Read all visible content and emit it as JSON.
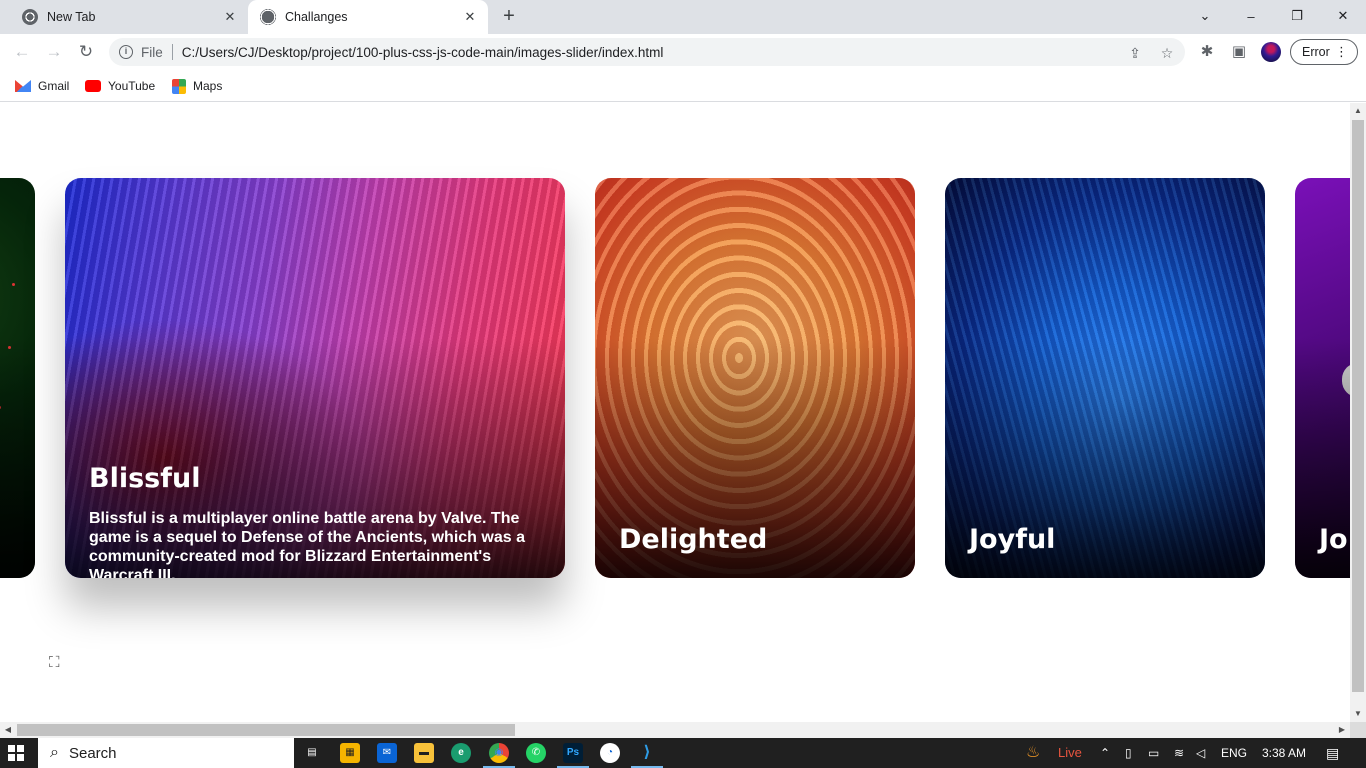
{
  "browser": {
    "tabs": [
      {
        "title": "New Tab",
        "close_glyph": "✕"
      },
      {
        "title": "Challanges",
        "close_glyph": "✕"
      }
    ],
    "new_tab_glyph": "+",
    "window_controls": {
      "menu": "⌄",
      "minimize": "–",
      "restore": "❐",
      "close": "✕"
    },
    "nav": {
      "back": "←",
      "forward": "→",
      "reload": "↻"
    },
    "address": {
      "info_glyph": "i",
      "scheme_label": "File",
      "url": "C:/Users/CJ/Desktop/project/100-plus-css-js-code-main/images-slider/index.html",
      "share_glyph": "⇪",
      "star_glyph": "☆"
    },
    "toolbar": {
      "extensions_glyph": "✱",
      "sidepanel_glyph": "▣",
      "error_label": "Error",
      "menu_glyph": "⋮"
    },
    "bookmarks": [
      {
        "label": "Gmail"
      },
      {
        "label": "YouTube"
      },
      {
        "label": "Maps"
      }
    ]
  },
  "slider": {
    "cards": [
      {
        "title": "",
        "theme": "dark green"
      },
      {
        "title": "Blissful",
        "description": "Blissful is a multiplayer online battle arena by Valve. The game is a sequel to Defense of the Ancients, which was a community-created mod for Blizzard Entertainment's Warcraft III.",
        "expanded": true
      },
      {
        "title": "Delighted"
      },
      {
        "title": "Joyful"
      },
      {
        "title": "Jo"
      }
    ],
    "page_logo_glyph": "⛶"
  },
  "scrollbars": {
    "up": "▲",
    "down": "▼",
    "left": "◀",
    "right": "▶"
  },
  "taskbar": {
    "search_label": "Search",
    "search_glyph": "⌕",
    "apps": [
      {
        "name": "task-view",
        "glyph": "▤"
      },
      {
        "name": "store",
        "glyph": "▦"
      },
      {
        "name": "mail",
        "glyph": "✉"
      },
      {
        "name": "file-explorer",
        "glyph": "▬"
      },
      {
        "name": "edge",
        "glyph": "e"
      },
      {
        "name": "chrome",
        "glyph": "◉"
      },
      {
        "name": "whatsapp",
        "glyph": "✆"
      },
      {
        "name": "photoshop",
        "glyph": "Ps"
      },
      {
        "name": "messenger",
        "glyph": "◔"
      },
      {
        "name": "vscode",
        "glyph": "⟩"
      }
    ],
    "live_label": "Live",
    "tray_chevron": "⌃",
    "language": "ENG",
    "time": "3:38 AM",
    "notification_glyph": "▤"
  },
  "colors": {
    "tabstrip": "#dee1e6",
    "omnibox": "#f1f3f4",
    "taskbar": "#202020",
    "live": "#e8553f"
  }
}
